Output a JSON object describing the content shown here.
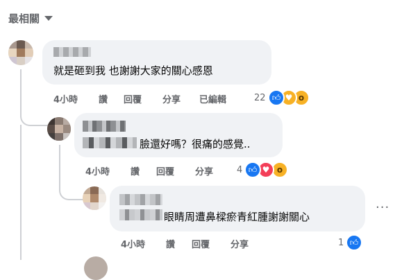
{
  "sort": {
    "label": "最相關"
  },
  "comments": [
    {
      "text": "就是砸到我 也謝謝大家的關心感恩",
      "time": "4小時",
      "like": "讚",
      "reply": "回覆",
      "share": "分享",
      "edited": "已編輯",
      "reaction_count": "22",
      "reactions": [
        "like-icon",
        "care-icon",
        "wow-icon"
      ]
    },
    {
      "text": "臉還好嗎？很痛的感覺..",
      "time": "4小時",
      "like": "讚",
      "reply": "回覆",
      "share": "分享",
      "reaction_count": "4",
      "reactions": [
        "like-icon",
        "love-icon",
        "wow-icon"
      ]
    },
    {
      "text": "眼睛周遭鼻樑瘀青紅腫謝謝關心",
      "time": "4小時",
      "like": "讚",
      "reply": "回覆",
      "share": "分享",
      "reaction_count": "1",
      "reactions": [
        "like-icon"
      ]
    }
  ],
  "more_menu": "···",
  "colors": {
    "like": "#1877f2",
    "love": "#f33e58",
    "wow": "#f7b125",
    "bubble": "#f0f2f5",
    "meta": "#65676b"
  }
}
